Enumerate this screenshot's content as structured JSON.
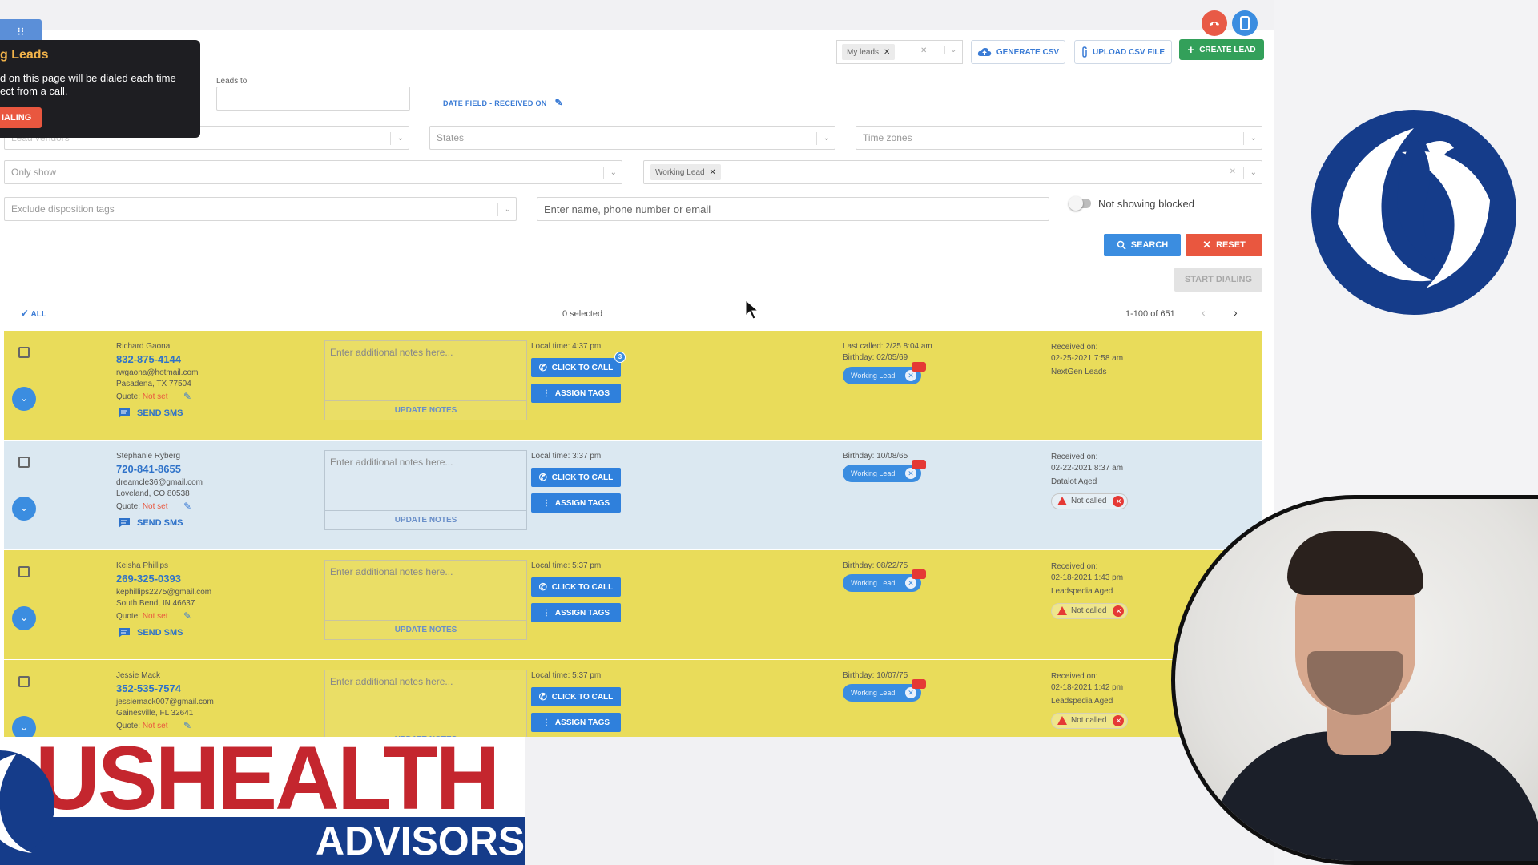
{
  "header": {
    "menu_glyph": "⁝⁝",
    "lead_filter_chip": "My leads",
    "generate_csv": "GENERATE CSV",
    "upload_csv": "UPLOAD CSV FILE",
    "create_lead": "CREATE LEAD"
  },
  "tooltip": {
    "title": "g Leads",
    "body": "d on this page will be dialed each time ect from a call.",
    "button": "IALING"
  },
  "filters": {
    "leads_to_label": "Leads to",
    "date_field_link": "DATE FIELD - RECEIVED ON",
    "lead_vendors_placeholder": "Lead vendors",
    "states_placeholder": "States",
    "timezones_placeholder": "Time zones",
    "only_show_placeholder": "Only show",
    "status_chip": "Working Lead",
    "exclude_tags_placeholder": "Exclude disposition tags",
    "search_placeholder": "Enter name, phone number or email",
    "blocked_toggle_label": "Not showing blocked",
    "search_button": "SEARCH",
    "reset_button": "RESET",
    "start_dialing_button": "START DIALING"
  },
  "list": {
    "select_all": "ALL",
    "selected_count": "0 selected",
    "pagination": "1-100 of 651"
  },
  "row_labels": {
    "notes_placeholder": "Enter additional notes here...",
    "update_notes": "UPDATE NOTES",
    "click_to_call": "CLICK TO CALL",
    "assign_tags": "ASSIGN TAGS",
    "send_sms": "SEND SMS",
    "quote_label": "Quote:",
    "quote_value": "Not set",
    "tag_working": "Working Lead",
    "not_called": "Not called",
    "received_label": "Received on:"
  },
  "leads": [
    {
      "name": "Richard Gaona",
      "phone": "832-875-4144",
      "email": "rwgaona@hotmail.com",
      "location": "Pasadena, TX 77504",
      "local_time": "Local time: 4:37 pm",
      "last_called": "Last called: 2/25 8:04 am",
      "birthday": "Birthday: 02/05/69",
      "received": "02-25-2021 7:58 am",
      "vendor": "NextGen Leads",
      "call_badge": "3",
      "color": "yellow"
    },
    {
      "name": "Stephanie Ryberg",
      "phone": "720-841-8655",
      "email": "dreamcle36@gmail.com",
      "location": "Loveland, CO 80538",
      "local_time": "Local time: 3:37 pm",
      "birthday": "Birthday: 10/08/65",
      "received": "02-22-2021 8:37 am",
      "vendor": "Datalot Aged",
      "color": "blue"
    },
    {
      "name": "Keisha Phillips",
      "phone": "269-325-0393",
      "email": "kephillips2275@gmail.com",
      "location": "South Bend, IN 46637",
      "local_time": "Local time: 5:37 pm",
      "birthday": "Birthday: 08/22/75",
      "received": "02-18-2021 1:43 pm",
      "vendor": "Leadspedia Aged",
      "color": "yellow"
    },
    {
      "name": "Jessie Mack",
      "phone": "352-535-7574",
      "email": "jessiemack007@gmail.com",
      "location": "Gainesville, FL 32641",
      "local_time": "Local time: 5:37 pm",
      "birthday": "Birthday: 10/07/75",
      "received": "02-18-2021 1:42 pm",
      "vendor": "Leadspedia Aged",
      "color": "yellow"
    }
  ],
  "overlays": {
    "banner_top": "USHEALTH",
    "banner_bottom": "ADVISORS"
  },
  "colors": {
    "row_yellow": "#e9dc5a",
    "row_blue": "#dbe8f1",
    "primary_blue": "#3b8de0",
    "danger_red": "#e9573f",
    "success_green": "#33a05a",
    "brand_navy": "#153c8a"
  },
  "icons": [
    "menu-icon",
    "hangup-icon",
    "phone-icon",
    "cloud-upload-icon",
    "paperclip-icon",
    "plus-icon",
    "pencil-icon",
    "search-icon",
    "close-icon",
    "check-icon",
    "chevron-left-icon",
    "chevron-right-icon",
    "chevron-down-icon",
    "chat-icon",
    "kebab-icon",
    "warning-icon",
    "flag-icon",
    "cursor-icon",
    "ushealth-logo-icon"
  ]
}
